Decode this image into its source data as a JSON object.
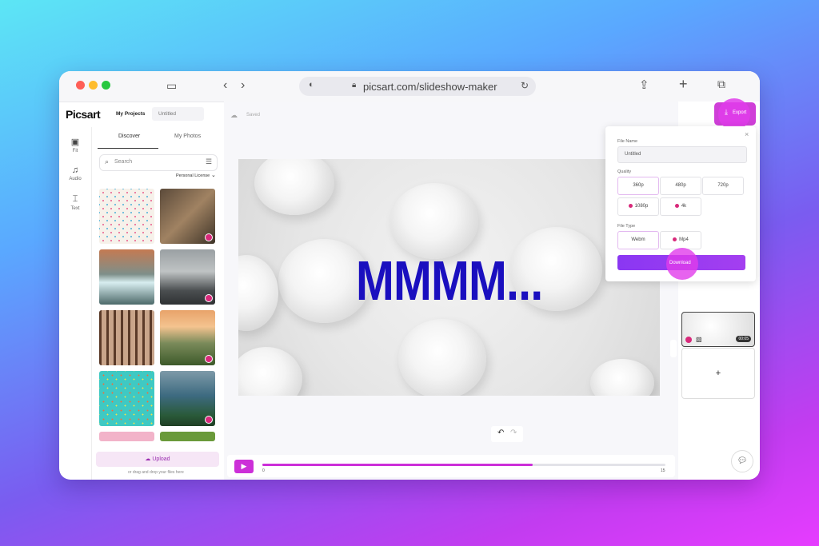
{
  "browser": {
    "url": "picsart.com/slideshow-maker"
  },
  "app": {
    "logo": "Picsart",
    "my_projects": "My Projects",
    "project_name": "Untitled",
    "saved": "Saved"
  },
  "rail": [
    {
      "label": "Fit",
      "icon": "fit-icon"
    },
    {
      "label": "Audio",
      "icon": "music-icon"
    },
    {
      "label": "Text",
      "icon": "text-icon"
    }
  ],
  "panel": {
    "tabs": [
      "Discover",
      "My Photos"
    ],
    "search_placeholder": "Search",
    "license": "Personal License",
    "upload": "Upload",
    "upload_hint": "or drag and drop your files here"
  },
  "canvas": {
    "overlay_text": "MMMM..."
  },
  "player": {
    "progress": 0.67,
    "start": "0",
    "end": "15"
  },
  "export": {
    "button": "Export",
    "file_name_label": "File Name",
    "file_name": "Untitled",
    "quality_label": "Quality",
    "quality_options": [
      "360p",
      "480p",
      "720p",
      "1080p",
      "4k"
    ],
    "file_type_label": "File Type",
    "file_types": [
      "Webm",
      "Mp4"
    ],
    "download": "Download",
    "close": "×"
  },
  "timeline": {
    "duration": "00:05",
    "add": "+"
  }
}
